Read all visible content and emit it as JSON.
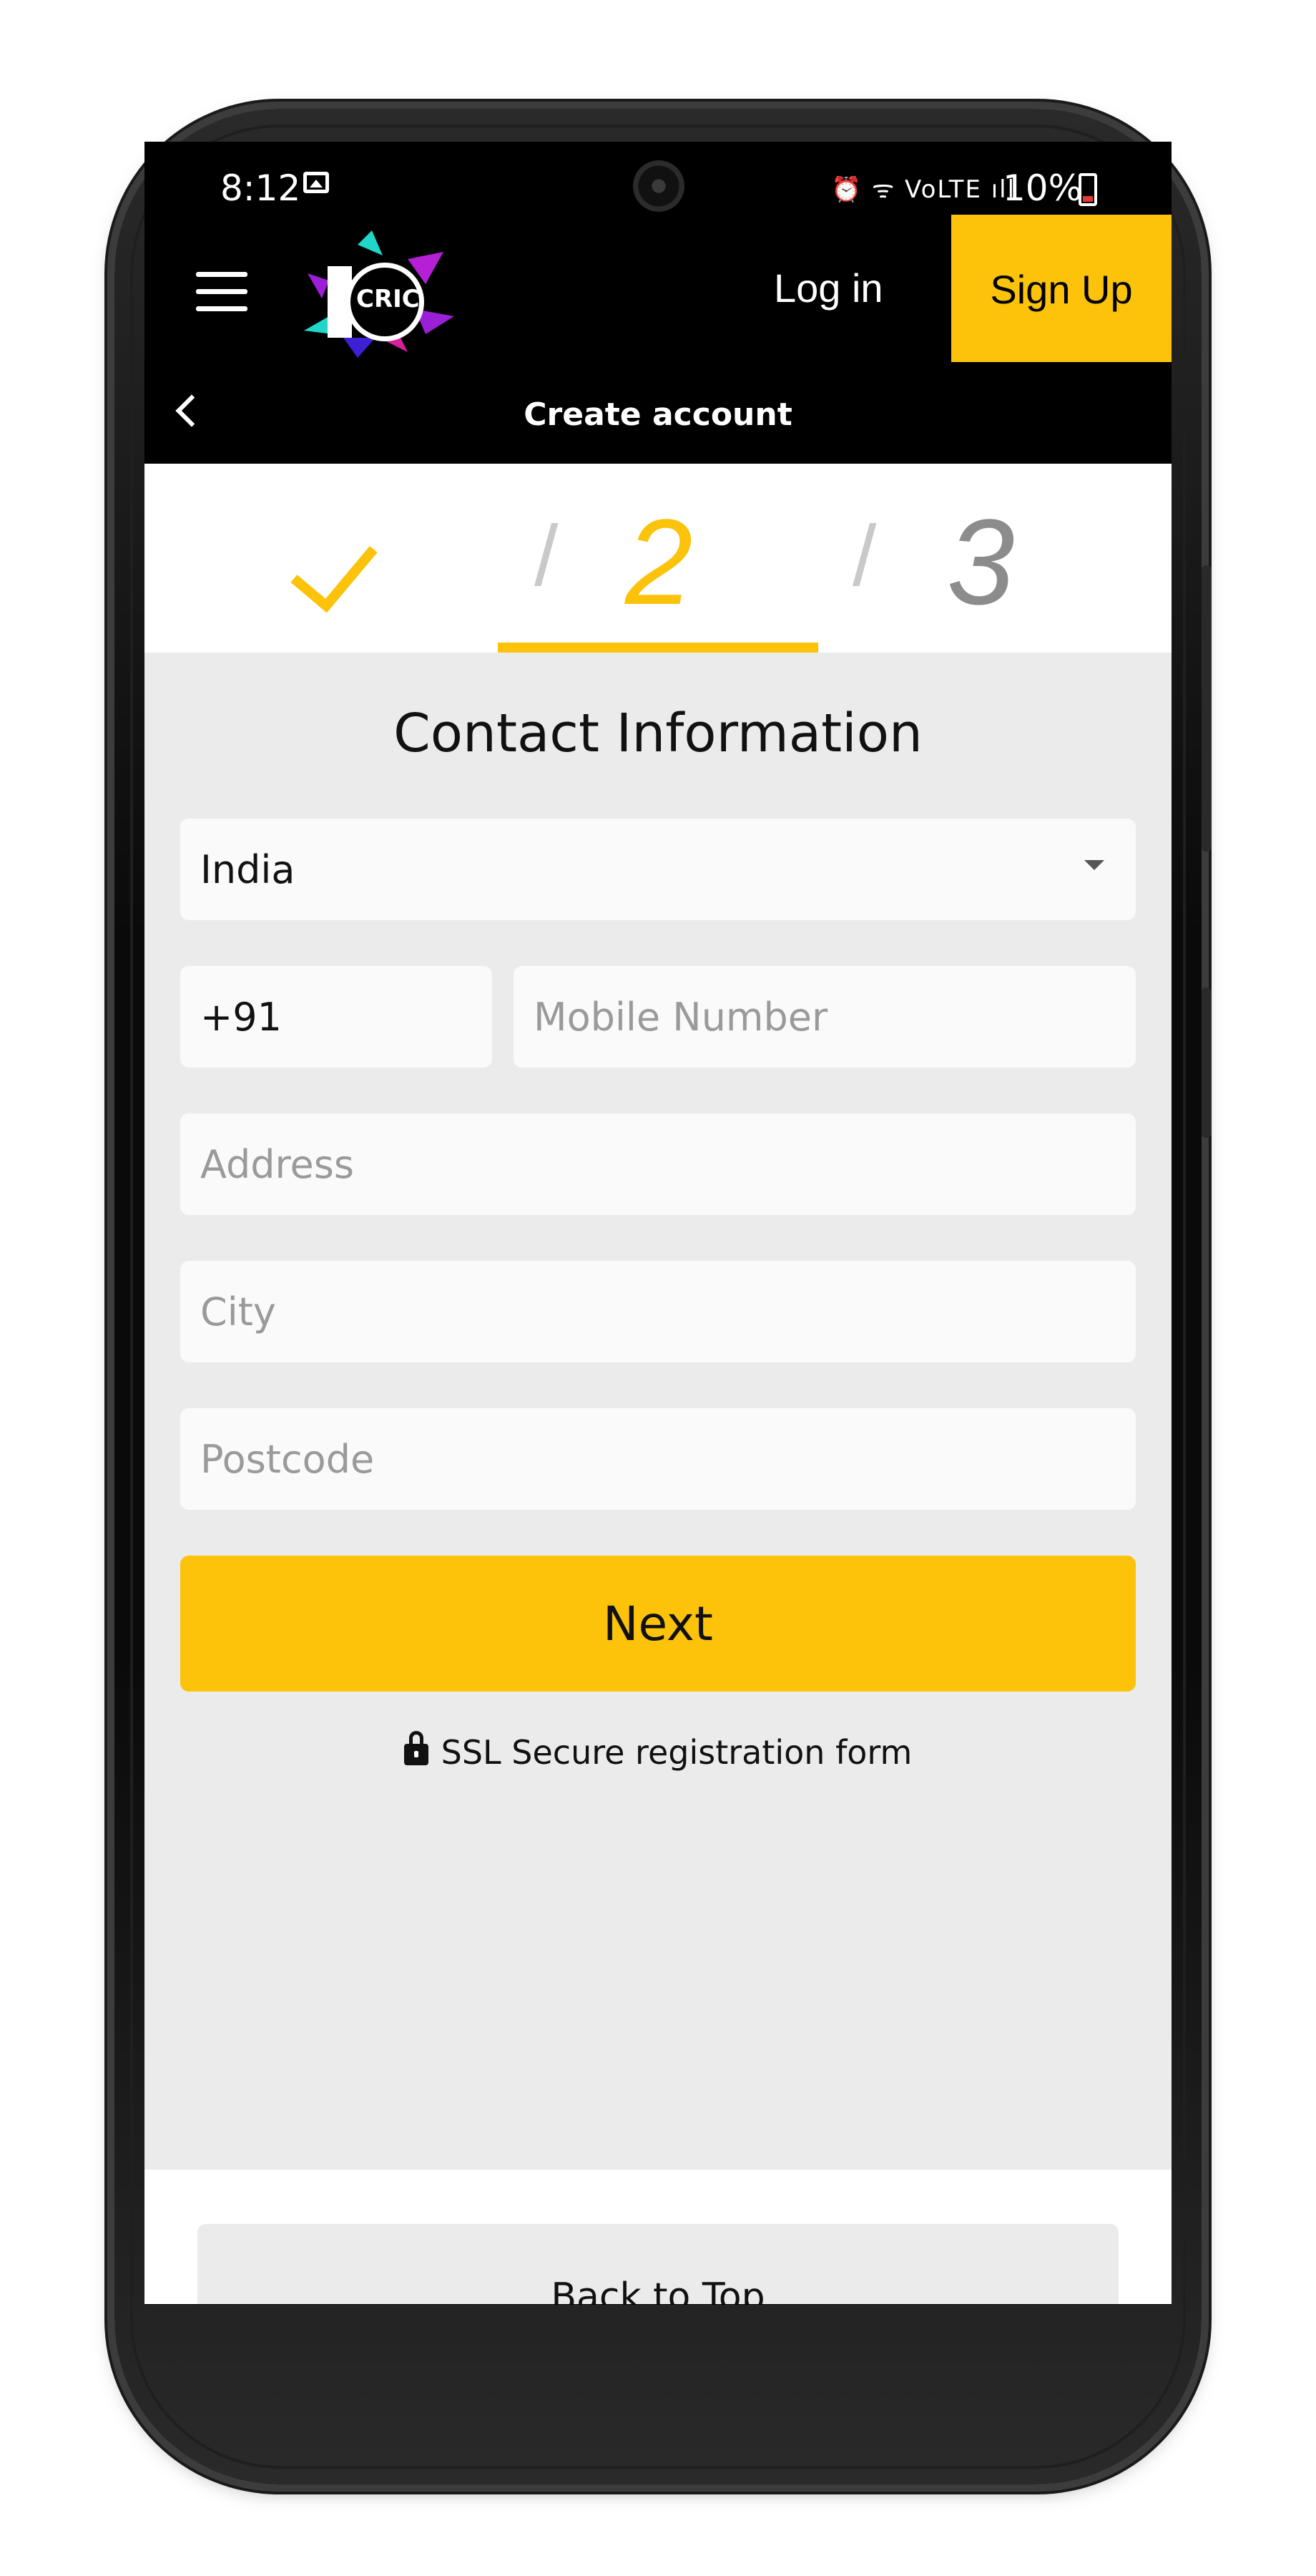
{
  "status_bar": {
    "time": "8:12",
    "system_icons": "⏰ ᯤ VoLTE ıll",
    "battery_percent": "10%"
  },
  "header": {
    "logo_text": "CRIC",
    "login_label": "Log in",
    "signup_label": "Sign Up"
  },
  "subheader": {
    "title": "Create account"
  },
  "steps": {
    "separator": "/",
    "active_step": "2",
    "next_step": "3"
  },
  "form": {
    "title": "Contact Information",
    "country_value": "India",
    "phone_prefix": "+91",
    "mobile_placeholder": "Mobile Number",
    "address_placeholder": "Address",
    "city_placeholder": "City",
    "postcode_placeholder": "Postcode",
    "next_label": "Next",
    "ssl_text": "SSL Secure registration form"
  },
  "footer": {
    "back_to_top_label": "Back to Top"
  },
  "colors": {
    "accent": "#fcc30a",
    "header_bg": "#000000",
    "form_bg": "#ebebeb",
    "field_bg": "#fafafa",
    "placeholder": "#9a9a9a",
    "inactive_step": "#8c8c8c"
  }
}
